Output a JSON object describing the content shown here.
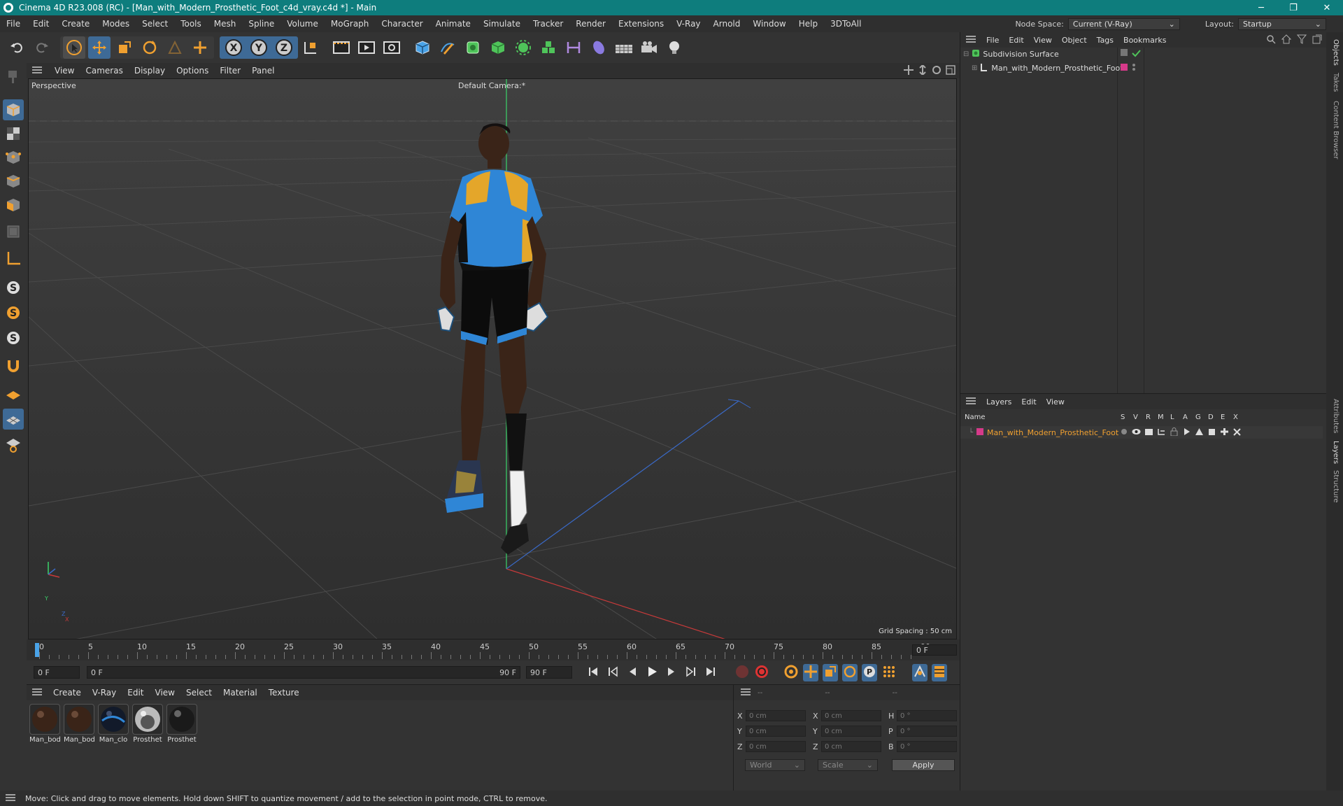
{
  "window": {
    "title": "Cinema 4D R23.008 (RC) - [Man_with_Modern_Prosthetic_Foot_c4d_vray.c4d *] - Main",
    "minimize": "─",
    "maximize": "❐",
    "close": "✕"
  },
  "menubar": {
    "items": [
      "File",
      "Edit",
      "Create",
      "Modes",
      "Select",
      "Tools",
      "Mesh",
      "Spline",
      "Volume",
      "MoGraph",
      "Character",
      "Animate",
      "Simulate",
      "Tracker",
      "Render",
      "Extensions",
      "V-Ray",
      "Arnold",
      "Window",
      "Help",
      "3DToAll"
    ],
    "node_space_label": "Node Space:",
    "node_space_value": "Current (V-Ray)",
    "layout_label": "Layout:",
    "layout_value": "Startup"
  },
  "viewport": {
    "menu": [
      "View",
      "Cameras",
      "Display",
      "Options",
      "Filter",
      "Panel"
    ],
    "projection": "Perspective",
    "camera": "Default Camera",
    "camera_suffix": ":*",
    "grid_spacing": "Grid Spacing : 50 cm",
    "axis_y": "Y",
    "axis_z": "Z",
    "axis_x": "X"
  },
  "timeline": {
    "ticks": [
      "0",
      "5",
      "10",
      "15",
      "20",
      "25",
      "30",
      "35",
      "40",
      "45",
      "50",
      "55",
      "60",
      "65",
      "70",
      "75",
      "80",
      "85",
      "90"
    ],
    "current_frame_right": "0 F",
    "start_field": "0 F",
    "range_start": "0 F",
    "range_end": "90 F",
    "end_field": "90 F"
  },
  "materials": {
    "menu": [
      "Create",
      "V-Ray",
      "Edit",
      "View",
      "Select",
      "Material",
      "Texture"
    ],
    "items": [
      "Man_bod",
      "Man_bod",
      "Man_clo",
      "Prosthet",
      "Prosthet"
    ]
  },
  "attributes": {
    "header": [
      "--",
      "--",
      "--"
    ],
    "rows": [
      {
        "a": "X",
        "av": "0 cm",
        "b": "X",
        "bv": "0 cm",
        "c": "H",
        "cv": "0 °"
      },
      {
        "a": "Y",
        "av": "0 cm",
        "b": "Y",
        "bv": "0 cm",
        "c": "P",
        "cv": "0 °"
      },
      {
        "a": "Z",
        "av": "0 cm",
        "b": "Z",
        "bv": "0 cm",
        "c": "B",
        "cv": "0 °"
      }
    ],
    "coord_mode": "World",
    "scale_mode": "Scale",
    "apply_label": "Apply"
  },
  "objects": {
    "menu": [
      "File",
      "Edit",
      "View",
      "Object",
      "Tags",
      "Bookmarks"
    ],
    "items": [
      "Subdivision Surface",
      "Man_with_Modern_Prosthetic_Foot"
    ]
  },
  "layers": {
    "menu": [
      "Layers",
      "Edit",
      "View"
    ],
    "columns": [
      "Name",
      "S",
      "V",
      "R",
      "M",
      "L",
      "A",
      "G",
      "D",
      "E",
      "X"
    ],
    "items": [
      "Man_with_Modern_Prosthetic_Foot"
    ],
    "layer_color": "#d63a8a"
  },
  "side_tabs": [
    "Objects",
    "Takes",
    "Content Browser",
    "Attributes",
    "Layers",
    "Structure"
  ],
  "status": "Move: Click and drag to move elements. Hold down SHIFT to quantize movement / add to the selection in point mode, CTRL to remove.",
  "colors": {
    "titlebar": "#0e7d7d",
    "accent": "#f0a030",
    "active_blue": "#4aa3e8"
  }
}
